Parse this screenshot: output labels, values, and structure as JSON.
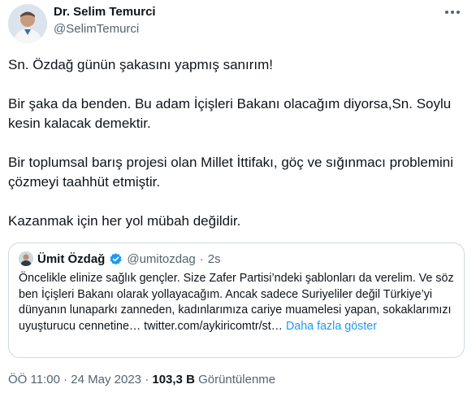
{
  "author": {
    "name": "Dr. Selim Temurci",
    "handle": "@SelimTemurci"
  },
  "tweet": {
    "paragraphs": [
      "Sn. Özdağ günün şakasını yapmış sanırım!",
      "Bir şaka da benden. Bu adam İçişleri Bakanı olacağım diyorsa,Sn. Soylu kesin kalacak demektir.",
      "Bir toplumsal barış projesi olan Millet İttifakı, göç ve sığınmacı problemini çözmeyi taahhüt etmiştir.",
      "Kazanmak için her yol mübah değildir."
    ]
  },
  "quote": {
    "name": "Ümit Özdağ",
    "handle": "@umitozdag",
    "separator": "·",
    "time": "2s",
    "text": "Öncelikle elinize sağlık gençler. Size Zafer Partisi’ndeki şablonları da verelim. Ve söz ben İçişleri Bakanı olarak yollayacağım. Ancak sadece Suriyeliler değil Türkiye’yi dünyanın lunaparkı zanneden, kadınlarımıza cariye muamelesi yapan, sokaklarımızı uyuşturucu cennetine… twitter.com/aykiricomtr/st…",
    "show_more": "Daha fazla göster"
  },
  "meta": {
    "time": "ÖÖ 11:00",
    "dot1": "·",
    "date": "24 May 2023",
    "dot2": "·",
    "views_count": "103,3 B",
    "views_label": "Görüntülenme"
  },
  "colors": {
    "link": "#1d9bf0",
    "muted": "#536471",
    "text": "#0f1419",
    "border": "#cfd9de"
  },
  "icons": {
    "more": "more-horizontal-icon",
    "verified": "verified-badge-icon"
  }
}
